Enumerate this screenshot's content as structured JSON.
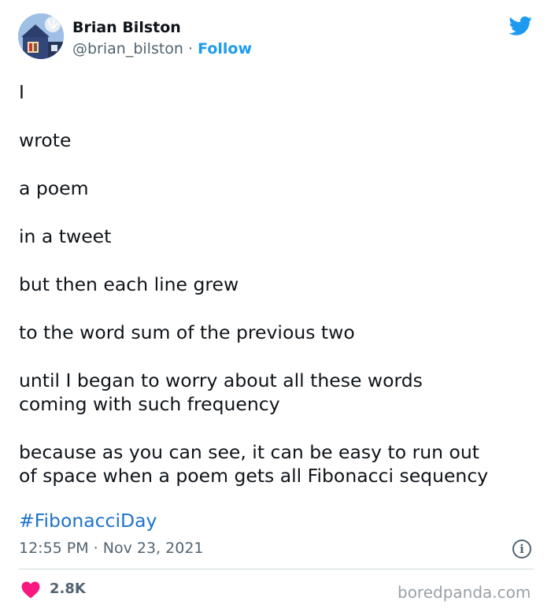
{
  "tweet": {
    "author_name": "Brian Bilston",
    "handle": "@brian_bilston",
    "separator": " · ",
    "follow_label": "Follow",
    "poem_lines": [
      [
        "I"
      ],
      [
        "wrote"
      ],
      [
        "a poem"
      ],
      [
        "in a tweet"
      ],
      [
        "but then each line grew"
      ],
      [
        "to the word sum of the previous two"
      ],
      [
        "until I began to worry about all these words",
        "coming with such frequency"
      ],
      [
        "because as you can see, it can be easy to run out",
        "of space when a poem gets all Fibonacci sequency"
      ]
    ],
    "hashtag": "#FibonacciDay",
    "timestamp": "12:55 PM · Nov 23, 2021",
    "info_glyph": "i",
    "like_count": "2.8K"
  },
  "icons": {
    "brand": "twitter-bird-icon",
    "info": "info-icon",
    "like": "heart-icon"
  },
  "colors": {
    "accent": "#1d9bf0",
    "hashtag": "#1d73c9",
    "heart": "#f91880",
    "muted": "#536471"
  },
  "watermark": "boredpanda.com"
}
